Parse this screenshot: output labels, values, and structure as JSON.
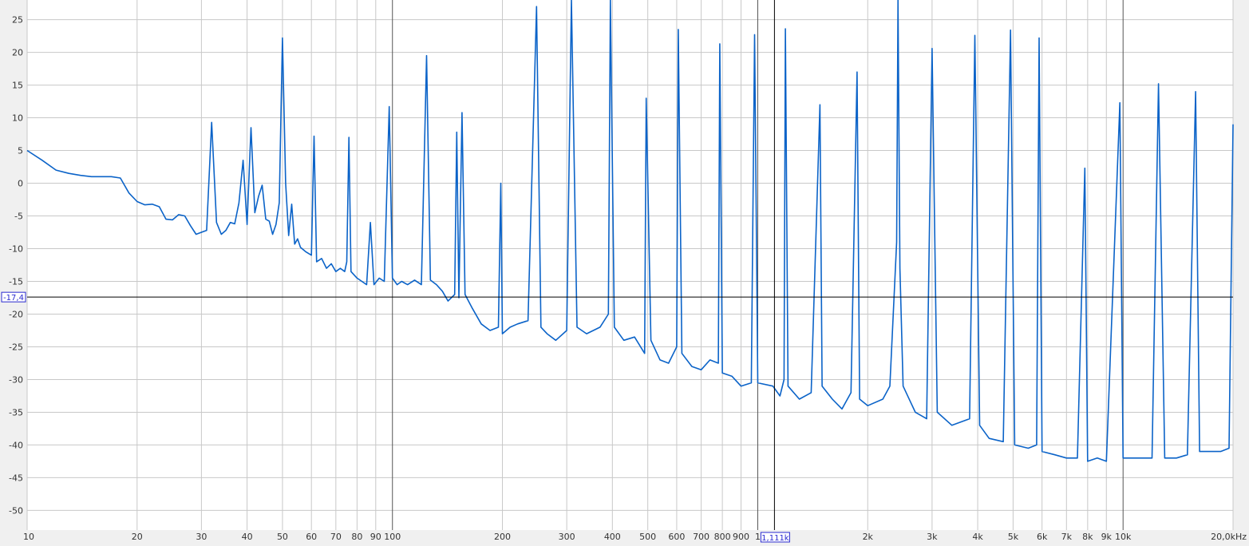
{
  "chart_data": {
    "type": "line",
    "x_scale": "log",
    "xlim": [
      10,
      20000
    ],
    "ylim": [
      -53,
      28
    ],
    "x_ticks": [
      {
        "v": 10,
        "label": "10"
      },
      {
        "v": 20,
        "label": "20"
      },
      {
        "v": 30,
        "label": "30"
      },
      {
        "v": 40,
        "label": "40"
      },
      {
        "v": 50,
        "label": "50"
      },
      {
        "v": 60,
        "label": "60"
      },
      {
        "v": 70,
        "label": "70"
      },
      {
        "v": 80,
        "label": "80"
      },
      {
        "v": 90,
        "label": "90"
      },
      {
        "v": 100,
        "label": "100"
      },
      {
        "v": 200,
        "label": "200"
      },
      {
        "v": 300,
        "label": "300"
      },
      {
        "v": 400,
        "label": "400"
      },
      {
        "v": 500,
        "label": "500"
      },
      {
        "v": 600,
        "label": "600"
      },
      {
        "v": 700,
        "label": "700"
      },
      {
        "v": 800,
        "label": "800"
      },
      {
        "v": 900,
        "label": "900"
      },
      {
        "v": 1000,
        "label": "1"
      },
      {
        "v": 2000,
        "label": "2k"
      },
      {
        "v": 3000,
        "label": "3k"
      },
      {
        "v": 4000,
        "label": "4k"
      },
      {
        "v": 5000,
        "label": "5k"
      },
      {
        "v": 6000,
        "label": "6k"
      },
      {
        "v": 7000,
        "label": "7k"
      },
      {
        "v": 8000,
        "label": "8k"
      },
      {
        "v": 9000,
        "label": "9k"
      },
      {
        "v": 10000,
        "label": "10k"
      },
      {
        "v": 20000,
        "label": "20,0kHz"
      }
    ],
    "y_ticks": [
      25,
      20,
      15,
      10,
      5,
      0,
      -5,
      -10,
      -15,
      -20,
      -25,
      -30,
      -35,
      -40,
      -45,
      -50
    ],
    "grid": true,
    "line_color": "#0b63c8",
    "cursor": {
      "x": 1111,
      "y": -17.4,
      "x_label": "1,111k",
      "y_label": "-17,4"
    },
    "series": [
      {
        "points": [
          [
            10,
            5
          ],
          [
            11,
            3.5
          ],
          [
            12,
            2
          ],
          [
            13,
            1.5
          ],
          [
            14,
            1.2
          ],
          [
            15,
            1
          ],
          [
            17,
            1
          ],
          [
            18,
            0.8
          ],
          [
            19,
            -1.5
          ],
          [
            20,
            -2.8
          ],
          [
            21,
            -3.3
          ],
          [
            22,
            -3.2
          ],
          [
            23,
            -3.6
          ],
          [
            24,
            -5.5
          ],
          [
            25,
            -5.6
          ],
          [
            26,
            -4.8
          ],
          [
            27,
            -5
          ],
          [
            28,
            -6.5
          ],
          [
            29,
            -7.8
          ],
          [
            30,
            -7.5
          ],
          [
            31,
            -7.2
          ],
          [
            32,
            9.3
          ],
          [
            33,
            -6
          ],
          [
            34,
            -7.8
          ],
          [
            35,
            -7.2
          ],
          [
            36,
            -6
          ],
          [
            37,
            -6.2
          ],
          [
            38,
            -3
          ],
          [
            39,
            3.5
          ],
          [
            40,
            -6.3
          ],
          [
            41,
            8.5
          ],
          [
            42,
            -4.5
          ],
          [
            43,
            -2
          ],
          [
            44,
            -0.3
          ],
          [
            45,
            -5.5
          ],
          [
            46,
            -5.8
          ],
          [
            47,
            -7.8
          ],
          [
            48,
            -6.3
          ],
          [
            49,
            -3
          ],
          [
            50,
            22.2
          ],
          [
            51,
            0
          ],
          [
            52,
            -8
          ],
          [
            53,
            -3.2
          ],
          [
            54,
            -9.3
          ],
          [
            55,
            -8.5
          ],
          [
            56,
            -9.8
          ],
          [
            58,
            -10.5
          ],
          [
            60,
            -11
          ],
          [
            61,
            7.2
          ],
          [
            62,
            -12
          ],
          [
            64,
            -11.5
          ],
          [
            66,
            -13
          ],
          [
            68,
            -12.3
          ],
          [
            70,
            -13.5
          ],
          [
            72,
            -13
          ],
          [
            74,
            -13.5
          ],
          [
            75,
            -12
          ],
          [
            76,
            7
          ],
          [
            77,
            -13.5
          ],
          [
            80,
            -14.5
          ],
          [
            85,
            -15.5
          ],
          [
            87,
            -6
          ],
          [
            89,
            -15.5
          ],
          [
            92,
            -14.5
          ],
          [
            95,
            -15
          ],
          [
            98,
            11.7
          ],
          [
            100,
            -14.5
          ],
          [
            103,
            -15.5
          ],
          [
            106,
            -15
          ],
          [
            110,
            -15.5
          ],
          [
            115,
            -14.8
          ],
          [
            120,
            -15.5
          ],
          [
            124,
            19.5
          ],
          [
            127,
            -14.8
          ],
          [
            132,
            -15.5
          ],
          [
            137,
            -16.5
          ],
          [
            142,
            -18
          ],
          [
            148,
            -17
          ],
          [
            150,
            7.8
          ],
          [
            152,
            -17.5
          ],
          [
            155,
            10.8
          ],
          [
            158,
            -17
          ],
          [
            165,
            -19
          ],
          [
            175,
            -21.5
          ],
          [
            185,
            -22.5
          ],
          [
            195,
            -22
          ],
          [
            198,
            0
          ],
          [
            200,
            -23
          ],
          [
            210,
            -22
          ],
          [
            220,
            -21.5
          ],
          [
            235,
            -21
          ],
          [
            248,
            27
          ],
          [
            255,
            -22
          ],
          [
            265,
            -23
          ],
          [
            280,
            -24
          ],
          [
            300,
            -22.5
          ],
          [
            309,
            28
          ],
          [
            320,
            -22
          ],
          [
            340,
            -23
          ],
          [
            370,
            -22
          ],
          [
            390,
            -20
          ],
          [
            395,
            28
          ],
          [
            405,
            -22
          ],
          [
            430,
            -24
          ],
          [
            460,
            -23.5
          ],
          [
            490,
            -26
          ],
          [
            495,
            13
          ],
          [
            510,
            -24
          ],
          [
            540,
            -27
          ],
          [
            570,
            -27.5
          ],
          [
            600,
            -25
          ],
          [
            606,
            23.5
          ],
          [
            620,
            -26
          ],
          [
            660,
            -28
          ],
          [
            700,
            -28.5
          ],
          [
            740,
            -27
          ],
          [
            780,
            -27.5
          ],
          [
            787,
            21.3
          ],
          [
            800,
            -29
          ],
          [
            850,
            -29.5
          ],
          [
            900,
            -31
          ],
          [
            960,
            -30.5
          ],
          [
            980,
            22.7
          ],
          [
            1000,
            -30.5
          ],
          [
            1100,
            -31
          ],
          [
            1150,
            -32.5
          ],
          [
            1180,
            -30
          ],
          [
            1190,
            23.6
          ],
          [
            1210,
            -31
          ],
          [
            1300,
            -33
          ],
          [
            1400,
            -32
          ],
          [
            1480,
            12
          ],
          [
            1500,
            -31
          ],
          [
            1600,
            -33
          ],
          [
            1700,
            -34.5
          ],
          [
            1800,
            -32
          ],
          [
            1870,
            17
          ],
          [
            1900,
            -33
          ],
          [
            2000,
            -34
          ],
          [
            2200,
            -33
          ],
          [
            2300,
            -31
          ],
          [
            2400,
            -9
          ],
          [
            2420,
            28
          ],
          [
            2450,
            -13
          ],
          [
            2500,
            -31
          ],
          [
            2700,
            -35
          ],
          [
            2900,
            -36
          ],
          [
            3000,
            20.6
          ],
          [
            3100,
            -35
          ],
          [
            3400,
            -37
          ],
          [
            3800,
            -36
          ],
          [
            3930,
            22.6
          ],
          [
            4050,
            -37
          ],
          [
            4300,
            -39
          ],
          [
            4700,
            -39.5
          ],
          [
            4920,
            23.4
          ],
          [
            5050,
            -40
          ],
          [
            5500,
            -40.5
          ],
          [
            5800,
            -40
          ],
          [
            5890,
            22.2
          ],
          [
            6000,
            -41
          ],
          [
            6500,
            -41.5
          ],
          [
            7000,
            -42
          ],
          [
            7500,
            -42
          ],
          [
            7860,
            2.3
          ],
          [
            8000,
            -42.5
          ],
          [
            8500,
            -42
          ],
          [
            9000,
            -42.5
          ],
          [
            9800,
            12.3
          ],
          [
            10000,
            -42
          ],
          [
            11000,
            -42
          ],
          [
            12000,
            -42
          ],
          [
            12500,
            15.2
          ],
          [
            13000,
            -42
          ],
          [
            14000,
            -42
          ],
          [
            15000,
            -41.5
          ],
          [
            15800,
            14
          ],
          [
            16200,
            -41
          ],
          [
            17500,
            -41
          ],
          [
            18500,
            -41
          ],
          [
            19500,
            -40.5
          ],
          [
            20000,
            9
          ]
        ]
      }
    ]
  }
}
